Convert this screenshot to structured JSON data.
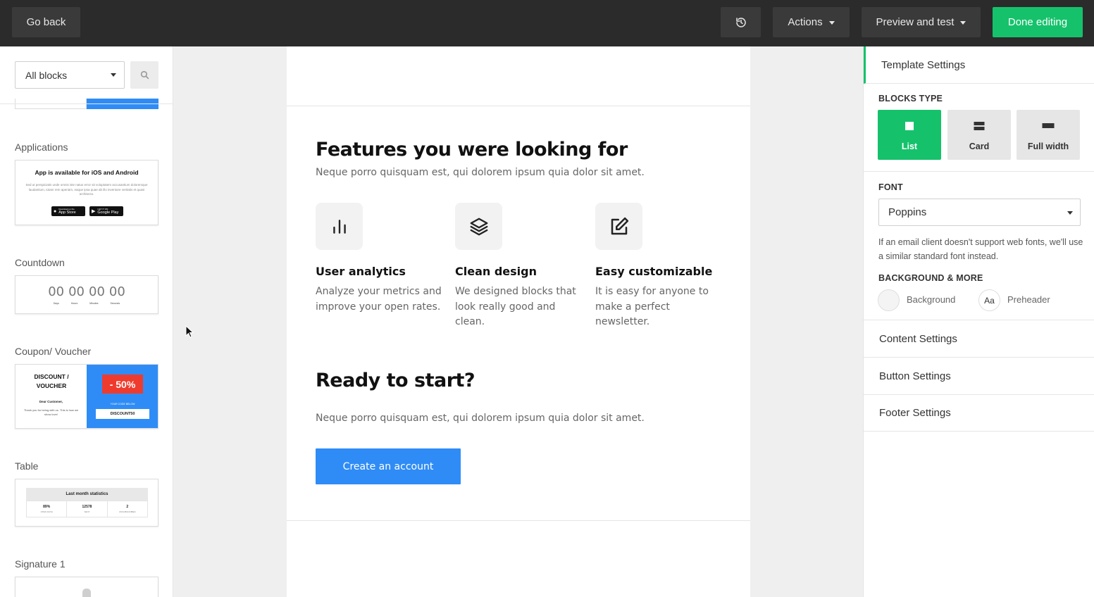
{
  "topbar": {
    "go_back": "Go back",
    "actions": "Actions",
    "preview": "Preview and test",
    "done": "Done editing"
  },
  "sidebar": {
    "filter_value": "All blocks",
    "categories": {
      "applications": "Applications",
      "countdown": "Countdown",
      "coupon": "Coupon/ Voucher",
      "table": "Table",
      "signature": "Signature 1"
    },
    "app_thumb": {
      "title": "App is available for iOS and Android",
      "body": "Sed ut perspiciatis unde omnis iste natus error sit voluptatem accusantium doloremque laudantium, totam rem aperiam, eaque ipsa quae ab illo inventore veritatis et quasi architecto.",
      "app_store_small": "Download on the",
      "app_store": "App Store",
      "google_small": "GET IT ON",
      "google": "Google Play"
    },
    "countdown_thumb": {
      "d": "00",
      "h": "00",
      "m": "00",
      "s": "00",
      "labels": [
        "Days",
        "Hours",
        "Minutes",
        "Seconds"
      ]
    },
    "coupon_thumb": {
      "title": "DISCOUNT / VOUCHER",
      "greeting": "Dear Customer,",
      "body": "Thank you for being with us. This is how we show love!",
      "discount": "- 50%",
      "code_label": "YOUR CODE BELOW",
      "code": "DISCOUNT50"
    },
    "table_thumb": {
      "title": "Last month statistics",
      "values": [
        "89%",
        "12578",
        "2"
      ],
      "labels": [
        "OPEN RATE",
        "SENT",
        "UNSUBSCRIBED"
      ]
    }
  },
  "email": {
    "features_title": "Features you were looking for",
    "features_lead": "Neque porro quisquam est, qui dolorem ipsum quia dolor sit amet.",
    "features": [
      {
        "title": "User analytics",
        "text": "Analyze your metrics and improve your open rates."
      },
      {
        "title": "Clean design",
        "text": "We designed blocks that look really good and clean."
      },
      {
        "title": "Easy customizable",
        "text": "It is easy for anyone to make a perfect newsletter."
      }
    ],
    "ready_title": "Ready to start?",
    "ready_lead": "Neque porro quisquam est, qui dolorem ipsum quia dolor sit amet.",
    "cta": "Create an account"
  },
  "rpanel": {
    "header": "Template Settings",
    "blocks_type_label": "BLOCKS TYPE",
    "blocks_type": [
      "List",
      "Card",
      "Full width"
    ],
    "blocks_type_selected": "List",
    "font_label": "FONT",
    "font_value": "Poppins",
    "font_note": "If an email client doesn't support web fonts, we'll use a similar standard font instead.",
    "bg_label": "BACKGROUND & MORE",
    "background": "Background",
    "preheader_glyph": "Aa",
    "preheader": "Preheader",
    "sections": [
      "Content Settings",
      "Button Settings",
      "Footer Settings"
    ]
  },
  "colors": {
    "accent_green": "#15c26b",
    "cta_blue": "#2f8cf6",
    "topbar": "#2b2b2b"
  }
}
